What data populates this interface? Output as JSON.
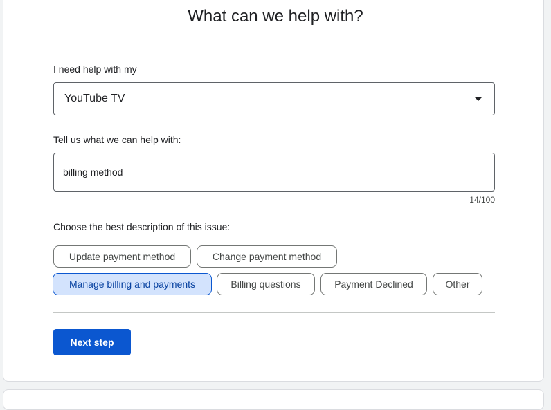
{
  "title": "What can we help with?",
  "product": {
    "label": "I need help with my",
    "selected": "YouTube TV"
  },
  "issue": {
    "label": "Tell us what we can help with:",
    "value": "billing method",
    "counter": "14/100"
  },
  "description": {
    "label": "Choose the best description of this issue:",
    "chips": [
      {
        "label": "Update payment method",
        "selected": false
      },
      {
        "label": "Change payment method",
        "selected": false
      },
      {
        "label": "Manage billing and payments",
        "selected": true
      },
      {
        "label": "Billing questions",
        "selected": false
      },
      {
        "label": "Payment Declined",
        "selected": false
      },
      {
        "label": "Other",
        "selected": false
      }
    ]
  },
  "actions": {
    "next_label": "Next step"
  },
  "colors": {
    "primary": "#0b57d0",
    "chip_selected_bg": "#d3e3fd"
  }
}
